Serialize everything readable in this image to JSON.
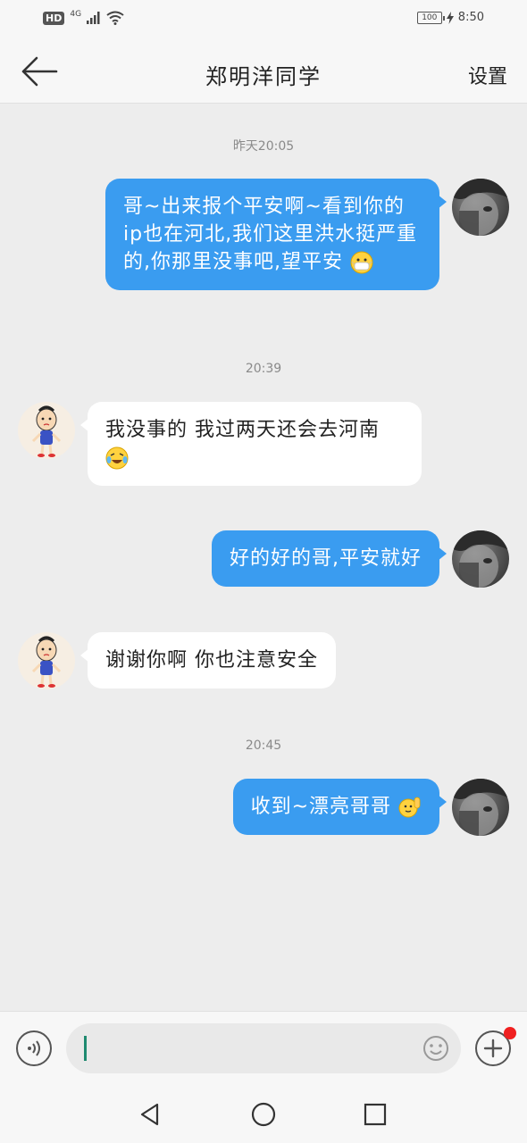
{
  "status_bar": {
    "network_badge": "HD",
    "network_type": "4G",
    "battery": "100",
    "time": "8:50"
  },
  "header": {
    "title": "郑明洋同学",
    "settings_label": "设置"
  },
  "colors": {
    "outgoing_bubble": "#3a9cf0",
    "incoming_bubble": "#ffffff",
    "background": "#ededed"
  },
  "chat": {
    "messages": [
      {
        "type": "timestamp",
        "text": "昨天20:05"
      },
      {
        "type": "outgoing",
        "text": "哥~出来报个平安啊~看到你的ip也在河北,我们这里洪水挺严重的,你那里没事吧,望平安",
        "emoji": "mask-face-emoji"
      },
      {
        "type": "timestamp",
        "text": "20:39"
      },
      {
        "type": "incoming",
        "text": "我没事的 我过两天还会去河南",
        "emoji": "crying-laughing-emoji"
      },
      {
        "type": "outgoing",
        "text": "好的好的哥,平安就好"
      },
      {
        "type": "incoming",
        "text": "谢谢你啊 你也注意安全"
      },
      {
        "type": "timestamp",
        "text": "20:45"
      },
      {
        "type": "outgoing",
        "text": "收到~漂亮哥哥",
        "emoji": "waving-hand-emoji"
      }
    ]
  },
  "input_bar": {
    "placeholder": "",
    "voice_icon": "voice-icon",
    "emoji_icon": "emoji-icon",
    "plus_icon": "plus-icon"
  },
  "nav_bar": {
    "back_icon": "triangle-back-icon",
    "home_icon": "circle-home-icon",
    "recents_icon": "square-recents-icon"
  }
}
